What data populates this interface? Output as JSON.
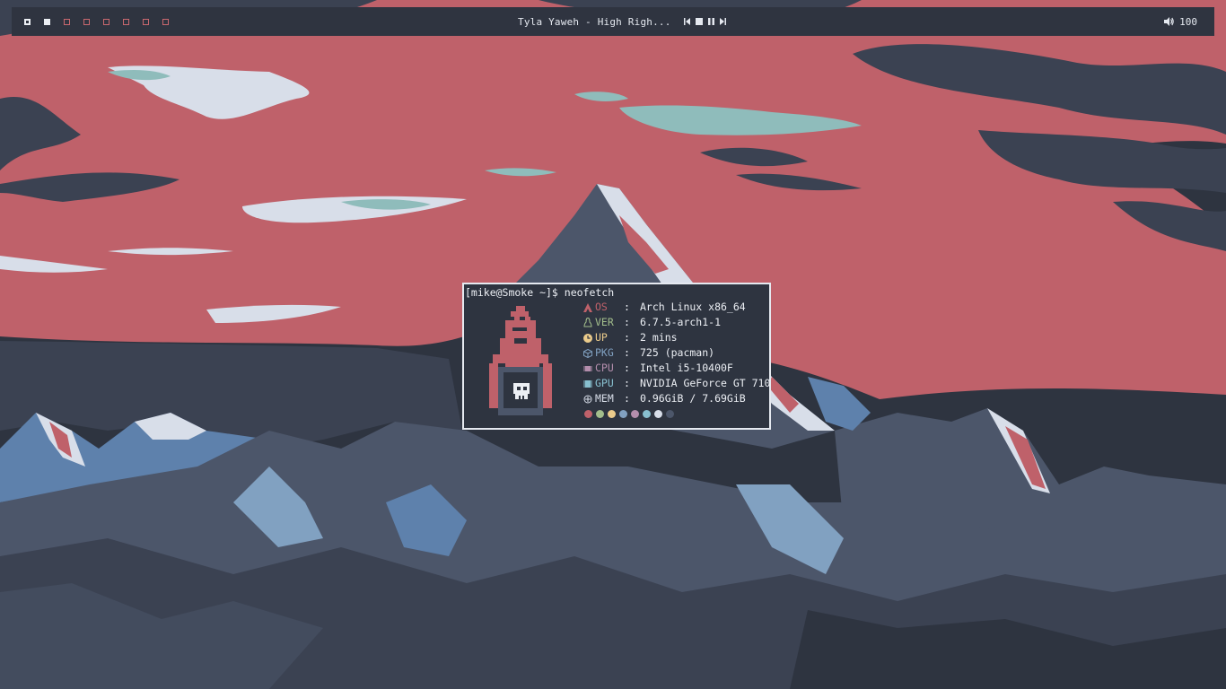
{
  "topbar": {
    "workspaces": [
      {
        "state": "focused"
      },
      {
        "state": "occupied"
      },
      {
        "state": "empty"
      },
      {
        "state": "empty"
      },
      {
        "state": "empty"
      },
      {
        "state": "empty"
      },
      {
        "state": "empty"
      },
      {
        "state": "empty"
      }
    ],
    "now_playing": "Tyla Yaweh - High Righ...",
    "media_controls": {
      "prev": "⏮",
      "stop": "■",
      "pause": "⏸",
      "next": "⏭"
    },
    "volume_icon": "speaker-icon",
    "volume": "100"
  },
  "terminal": {
    "prompt": "[mike@Smoke ~]$ neofetch",
    "info": [
      {
        "icon": "arch-icon",
        "key": "OS",
        "sep": ":",
        "value": "Arch Linux x86_64",
        "color": "#bf616a"
      },
      {
        "icon": "linux-icon",
        "key": "VER",
        "sep": ":",
        "value": "6.7.5-arch1-1",
        "color": "#a3be8c"
      },
      {
        "icon": "clock-icon",
        "key": "UP",
        "sep": ":",
        "value": "2 mins",
        "color": "#ebcb8b"
      },
      {
        "icon": "package-icon",
        "key": "PKG",
        "sep": ":",
        "value": "725 (pacman)",
        "color": "#81a1c1"
      },
      {
        "icon": "cpu-icon",
        "key": "CPU",
        "sep": ":",
        "value": "Intel i5-10400F",
        "color": "#b48ead"
      },
      {
        "icon": "gpu-icon",
        "key": "GPU",
        "sep": ":",
        "value": "NVIDIA GeForce GT 710",
        "color": "#88c0d0"
      },
      {
        "icon": "memory-icon",
        "key": "MEM",
        "sep": ":",
        "value": "0.96GiB / 7.69GiB",
        "color": "#d8dee9"
      }
    ],
    "palette": [
      "#bf616a",
      "#a3be8c",
      "#ebcb8b",
      "#81a1c1",
      "#b48ead",
      "#88c0d0",
      "#d8dee9",
      "#4c566a"
    ]
  },
  "colors": {
    "bar_bg": "#2f3440",
    "sky": "#bf616a",
    "mountain_dark": "#3b4252",
    "mountain_blue": "#5e81ac",
    "snow": "#d8dee9",
    "cloud_teal": "#8fbcbb"
  }
}
